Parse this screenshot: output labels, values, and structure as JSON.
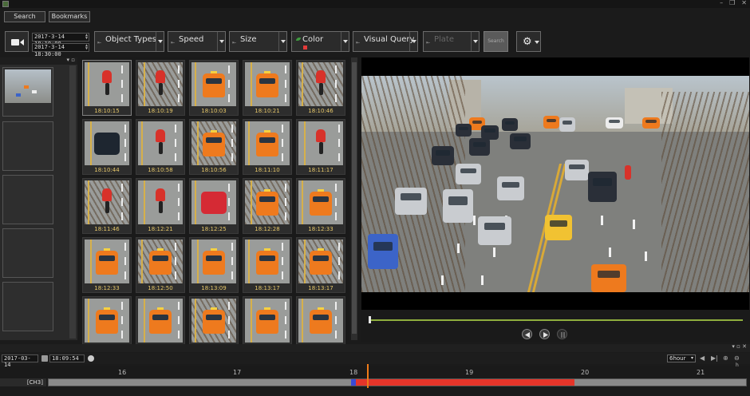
{
  "window": {
    "controls": [
      "–",
      "❐",
      "✕"
    ]
  },
  "nav": {
    "search_label": "Search",
    "bookmarks_label": "Bookmarks"
  },
  "time_range": {
    "start": "2017-3-14 18:10:00",
    "end": "2017-3-14 18:30:00"
  },
  "filters": {
    "object_types": "Object Types",
    "speed": "Speed",
    "size": "Size",
    "color": "Color",
    "visual_query": "Visual Query",
    "plate": "Plate"
  },
  "search_button": "Search",
  "accent": {
    "selected_color": "#e53a3a",
    "timeline_hit": "#e5352a",
    "timeline_cursor": "#f07a18",
    "progress": "#8fae3e"
  },
  "thumbnails": [
    {
      "time": "18:10:15",
      "kind": "moto"
    },
    {
      "time": "18:10:19",
      "kind": "moto"
    },
    {
      "time": "18:10:03",
      "kind": "taxi"
    },
    {
      "time": "18:10:21",
      "kind": "taxi"
    },
    {
      "time": "18:10:46",
      "kind": "moto"
    },
    {
      "time": "18:10:44",
      "kind": "dark"
    },
    {
      "time": "18:10:58",
      "kind": "moto"
    },
    {
      "time": "18:10:56",
      "kind": "taxi"
    },
    {
      "time": "18:11:10",
      "kind": "taxi"
    },
    {
      "time": "18:11:17",
      "kind": "moto"
    },
    {
      "time": "18:11:46",
      "kind": "moto"
    },
    {
      "time": "18:12:21",
      "kind": "moto"
    },
    {
      "time": "18:12:25",
      "kind": "red"
    },
    {
      "time": "18:12:28",
      "kind": "taxi"
    },
    {
      "time": "18:12:33",
      "kind": "taxi"
    },
    {
      "time": "18:12:33",
      "kind": "taxi"
    },
    {
      "time": "18:12:50",
      "kind": "taxi"
    },
    {
      "time": "18:13:09",
      "kind": "taxi"
    },
    {
      "time": "18:13:17",
      "kind": "taxi"
    },
    {
      "time": "18:13:17",
      "kind": "taxi"
    },
    {
      "time": "",
      "kind": "taxi"
    },
    {
      "time": "",
      "kind": "taxi"
    },
    {
      "time": "",
      "kind": "taxi"
    },
    {
      "time": "",
      "kind": "taxi"
    },
    {
      "time": "",
      "kind": "taxi"
    }
  ],
  "timeline": {
    "date": "2017-03-14",
    "time": "18:09:54",
    "zoom": "6hour",
    "h_label": "h",
    "hours": [
      "16",
      "17",
      "18",
      "19",
      "20",
      "21"
    ],
    "track_label": "[CH3]"
  }
}
